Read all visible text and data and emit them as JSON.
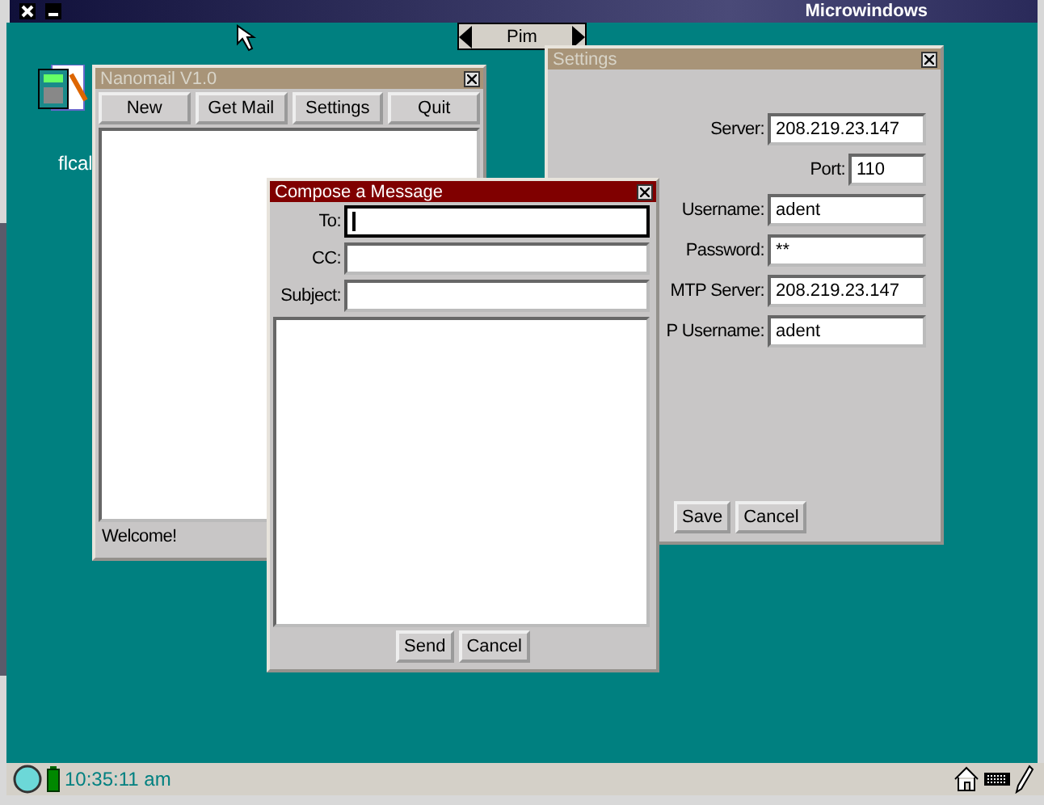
{
  "top_bar": {
    "title": "Microwindows"
  },
  "desktop_icons": [
    {
      "label": "flcal"
    }
  ],
  "app_tab": {
    "label": "Pim"
  },
  "nanomail": {
    "title": "Nanomail V1.0",
    "buttons": [
      "New",
      "Get Mail",
      "Settings",
      "Quit"
    ],
    "status": "Welcome!"
  },
  "settings": {
    "title": "Settings",
    "fields": [
      {
        "label": "Server:",
        "value": "208.219.23.147",
        "kind": "wide"
      },
      {
        "label": "Port:",
        "value": "110",
        "kind": "narrow"
      },
      {
        "label": "Username:",
        "value": "adent",
        "kind": "wide"
      },
      {
        "label": "Password:",
        "value": "**",
        "kind": "wide"
      },
      {
        "label": "MTP Server:",
        "value": "208.219.23.147",
        "kind": "wide"
      },
      {
        "label": "P Username:",
        "value": "adent",
        "kind": "wide"
      }
    ],
    "buttons": [
      "Save",
      "Cancel"
    ]
  },
  "compose": {
    "title": "Compose a Message",
    "fields": [
      {
        "label": "To:",
        "focused": true
      },
      {
        "label": "CC:",
        "focused": false
      },
      {
        "label": "Subject:",
        "focused": false
      }
    ],
    "buttons": [
      "Send",
      "Cancel"
    ]
  },
  "taskbar": {
    "clock": "10:35:11 am"
  }
}
